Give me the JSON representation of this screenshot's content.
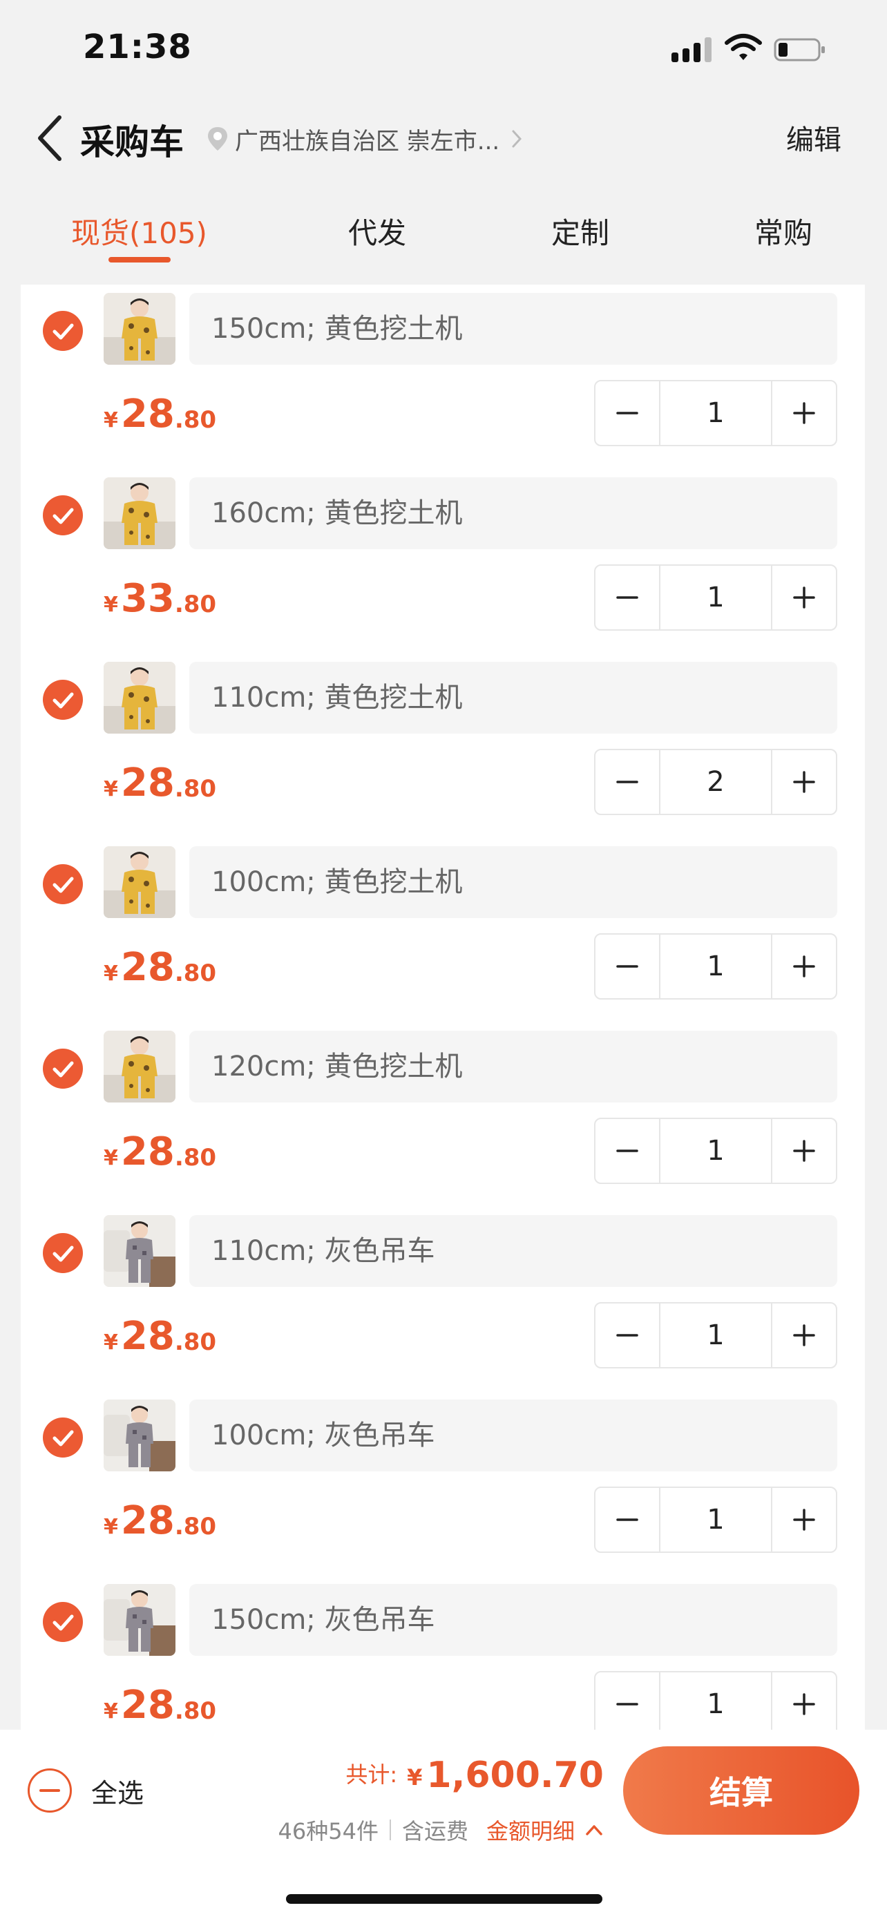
{
  "status": {
    "time": "21:38"
  },
  "nav": {
    "title": "采购车",
    "location": "广西壮族自治区 崇左市...",
    "edit": "编辑"
  },
  "tabs": [
    "现货(105)",
    "代发",
    "定制",
    "常购"
  ],
  "items": [
    {
      "spec": "150cm; 黄色挖土机",
      "price_int": "28",
      "price_dec": ".80",
      "qty": "1",
      "variant": "yellow"
    },
    {
      "spec": "160cm; 黄色挖土机",
      "price_int": "33",
      "price_dec": ".80",
      "qty": "1",
      "variant": "yellow"
    },
    {
      "spec": "110cm; 黄色挖土机",
      "price_int": "28",
      "price_dec": ".80",
      "qty": "2",
      "variant": "yellow"
    },
    {
      "spec": "100cm; 黄色挖土机",
      "price_int": "28",
      "price_dec": ".80",
      "qty": "1",
      "variant": "yellow"
    },
    {
      "spec": "120cm; 黄色挖土机",
      "price_int": "28",
      "price_dec": ".80",
      "qty": "1",
      "variant": "yellow"
    },
    {
      "spec": "110cm; 灰色吊车",
      "price_int": "28",
      "price_dec": ".80",
      "qty": "1",
      "variant": "gray"
    },
    {
      "spec": "100cm; 灰色吊车",
      "price_int": "28",
      "price_dec": ".80",
      "qty": "1",
      "variant": "gray"
    },
    {
      "spec": "150cm; 灰色吊车",
      "price_int": "28",
      "price_dec": ".80",
      "qty": "1",
      "variant": "gray"
    }
  ],
  "currency": "¥",
  "footer": {
    "select_all": "全选",
    "total_label": "共计:",
    "total_amount": "1,600.70",
    "count": "46种54件",
    "shipping": "含运费",
    "detail": "金额明细",
    "checkout": "结算"
  },
  "colors": {
    "accent": "#e8582c",
    "check": "#ec5a33",
    "yellow_product": "#e5b53c",
    "gray_product": "#8e8a93"
  },
  "icons": [
    "back-icon",
    "location-pin-icon",
    "chevron-right-icon",
    "check-icon",
    "minus-icon",
    "plus-icon",
    "chevron-up-icon",
    "signal-icon",
    "wifi-icon",
    "battery-icon"
  ]
}
